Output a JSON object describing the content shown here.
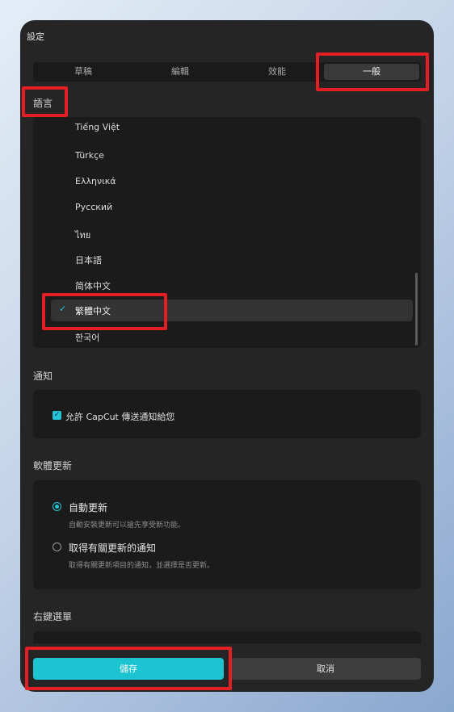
{
  "dialog": {
    "title": "設定"
  },
  "tabs": [
    {
      "label": "草稿"
    },
    {
      "label": "編輯"
    },
    {
      "label": "效能"
    },
    {
      "label": "一般"
    }
  ],
  "language": {
    "label": "語言",
    "items": [
      "Tiếng Việt",
      "Türkçe",
      "Ελληνικά",
      "Русский",
      "ไทย",
      "日本語",
      "简体中文"
    ],
    "selected": "繁體中文",
    "after": "한국어"
  },
  "notifications": {
    "label": "通知",
    "checkbox_label": "允許 CapCut 傳送通知給您",
    "checked": true
  },
  "software_update": {
    "label": "軟體更新",
    "options": [
      {
        "title": "自動更新",
        "desc": "自動安裝更新可以搶先享受新功能。"
      },
      {
        "title": "取得有關更新的通知",
        "desc": "取得有關更新項目的通知，並選擇是否更新。"
      }
    ]
  },
  "context_menu": {
    "label": "右鍵選單"
  },
  "buttons": {
    "save": "儲存",
    "cancel": "取消"
  },
  "colors": {
    "accent": "#1cc3d1",
    "highlight": "#e31e24"
  }
}
